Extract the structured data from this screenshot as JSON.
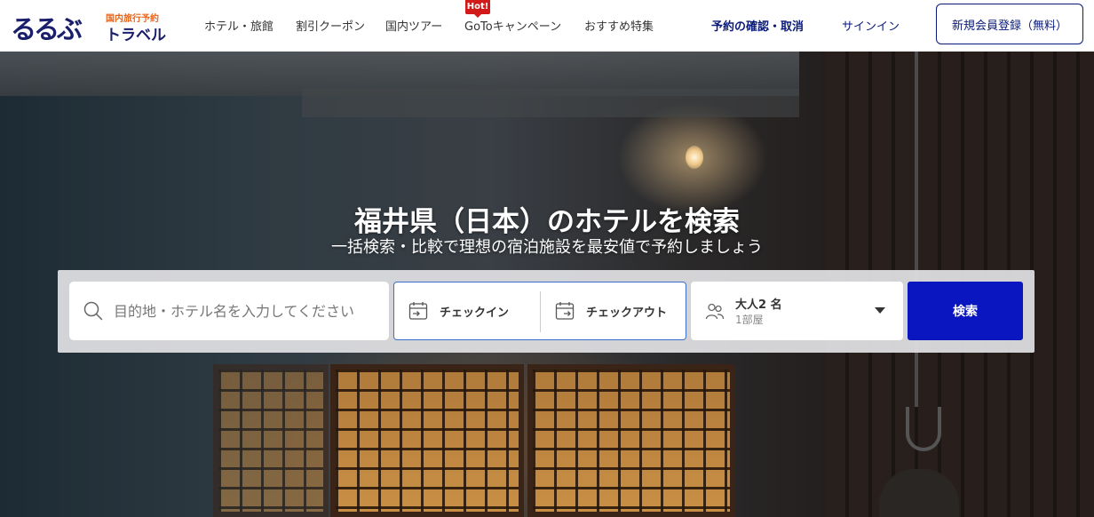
{
  "header": {
    "logo": {
      "main": "るるぶ",
      "sub": "国内旅行予約",
      "travel": "トラベル"
    },
    "nav": [
      {
        "label": "ホテル・旅館"
      },
      {
        "label": "割引クーポン"
      },
      {
        "label": "国内ツアー"
      },
      {
        "label": "GoToキャンペーン",
        "badge": "Hot!"
      },
      {
        "label": "おすすめ特集"
      }
    ],
    "reservation_check": "予約の確認・取消",
    "sign_in": "サインイン",
    "register": "新規会員登録（無料）"
  },
  "hero": {
    "title": "福井県（日本）のホテルを検索",
    "subtitle": "一括検索・比較で理想の宿泊施設を最安値で予約しましょう"
  },
  "search": {
    "destination_placeholder": "目的地・ホテル名を入力してください",
    "destination_value": "",
    "checkin_label": "チェックイン",
    "checkout_label": "チェックアウト",
    "guests_label": "大人2 名",
    "rooms_label": "1部屋",
    "search_button": "検索"
  },
  "colors": {
    "brand_navy": "#1a1f6b",
    "logo_orange": "#e8661b",
    "hot_badge": "#d21a1a",
    "search_button": "#0a16c0",
    "date_border": "#3a6fd0"
  },
  "icons": [
    "search-icon",
    "checkin-calendar-icon",
    "checkout-calendar-icon",
    "people-icon",
    "chevron-down-icon"
  ]
}
